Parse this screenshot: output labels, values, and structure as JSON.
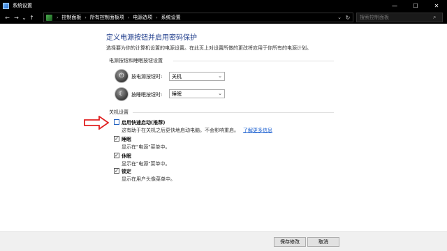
{
  "window": {
    "title": "系统设置",
    "controls": {
      "minimize": "—",
      "maximize": "☐",
      "close": "✕"
    }
  },
  "address": {
    "crumbs": [
      "控制面板",
      "所有控制面板项",
      "电源选项",
      "系统设置"
    ],
    "search_placeholder": "搜索控制面板"
  },
  "main": {
    "title": "定义电源按钮并启用密码保护",
    "description": "选择要为你的计算机设置的电源设置。在此页上对设置所做的更改将应用于你所有的电源计划。",
    "power_section": {
      "heading": "电源按钮和睡眠按钮设置",
      "rows": [
        {
          "label": "按电源按钮时:",
          "value": "关机"
        },
        {
          "label": "按睡眠按钮时:",
          "value": "睡眠"
        }
      ]
    },
    "shutdown_section": {
      "heading": "关机设置",
      "items": [
        {
          "label": "启用快速启动(推荐)",
          "desc": "这有助于在关机之后更快地启动电脑。不会影响重启。",
          "link": "了解更多信息",
          "checked": false
        },
        {
          "label": "睡眠",
          "desc": "显示在\"电源\"菜单中。",
          "checked": true
        },
        {
          "label": "休眠",
          "desc": "显示在\"电源\"菜单中。",
          "checked": true
        },
        {
          "label": "锁定",
          "desc": "显示在用户头像菜单中。",
          "checked": true
        }
      ]
    }
  },
  "footer": {
    "save_label": "保存修改",
    "cancel_label": "取消"
  },
  "colors": {
    "title_blue": "#1f3d8c",
    "link_blue": "#1a5fd0",
    "annotation_red": "#e02020"
  },
  "icons": {
    "back": "←",
    "forward": "→",
    "recent": "⌄",
    "up": "↑",
    "chevron": "›",
    "dropdown": "⌄",
    "refresh": "↻",
    "search": "⌕",
    "power": "⏻",
    "sleep": "☾",
    "check": "✓"
  }
}
